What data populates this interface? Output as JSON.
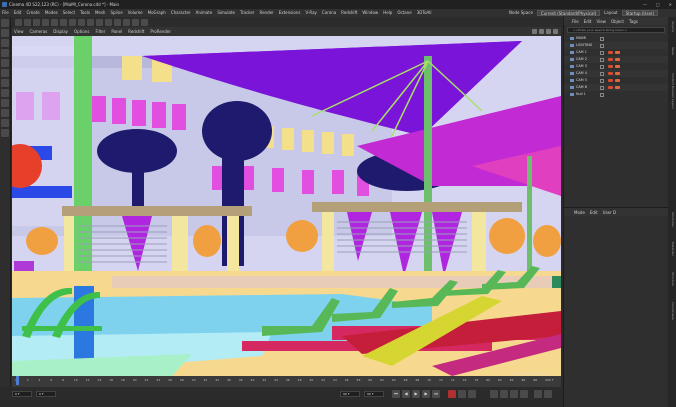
{
  "window": {
    "title": "Cinema 4D S22.123 (RC) - [MiaMI_Corona.c4d *] - Main",
    "controls": [
      "—",
      "□",
      "✕"
    ]
  },
  "menubar": {
    "items": [
      "File",
      "Edit",
      "Create",
      "Modes",
      "Select",
      "Tools",
      "Mesh",
      "Spline",
      "Volume",
      "MoGraph",
      "Character",
      "Animate",
      "Simulate",
      "Tracker",
      "Render",
      "Extensions",
      "V-Ray",
      "Corona",
      "Redshift",
      "Window",
      "Help",
      "Octane",
      "3DToAll"
    ],
    "node_space_label": "Node Space",
    "node_space_value": "Current (Standard/Physical)",
    "layout_label": "Layout",
    "layout_value": "Startup (User)"
  },
  "viewport_menu": {
    "items": [
      "View",
      "Cameras",
      "Display",
      "Options",
      "Filter",
      "Panel",
      "Redshift",
      "ProRender"
    ]
  },
  "object_manager": {
    "menu": [
      "File",
      "Edit",
      "View",
      "Object",
      "Tags"
    ],
    "search_placeholder": "<<Enter your search string here>>",
    "objects": [
      "MIAMI",
      "LIGHTING",
      "CAM 1",
      "CAM 2",
      "CAM 3",
      "CAM 4",
      "CAM 5",
      "CAM 6",
      "Null 1"
    ]
  },
  "attribute_manager": {
    "menu": [
      "Mode",
      "Edit",
      "User D"
    ]
  },
  "side_tabs": [
    "Objects",
    "Takes",
    "Content Browser",
    "Layers",
    "Attributes",
    "Materials",
    "Structure",
    "Coordinates"
  ],
  "timeline": {
    "ticks": [
      "0",
      "2",
      "4",
      "6",
      "8",
      "10",
      "12",
      "14",
      "16",
      "18",
      "20",
      "22",
      "24",
      "26",
      "28",
      "30",
      "32",
      "34",
      "36",
      "38",
      "40",
      "42",
      "44",
      "46",
      "48",
      "50",
      "52",
      "54",
      "56",
      "58",
      "60",
      "62",
      "64",
      "66",
      "68",
      "70",
      "72",
      "74",
      "76",
      "78",
      "80",
      "82",
      "84",
      "86",
      "88",
      "90"
    ],
    "end_frame": "0 F"
  },
  "transport": {
    "current_frame": "0 F",
    "start_frame": "0 F",
    "end_frame": "90 F",
    "end_frame_2": "90 F"
  },
  "viewport_label": "Grid Spacing : 100 cm"
}
